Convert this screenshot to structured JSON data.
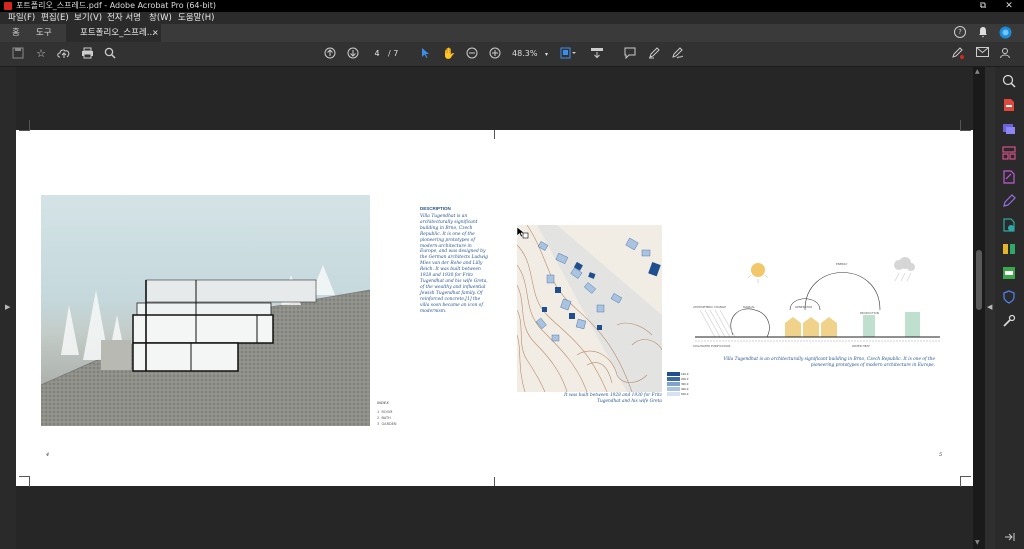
{
  "window": {
    "title": "포트폴리오_스프레드.pdf - Adobe Acrobat Pro (64-bit)",
    "controls": [
      "⧉",
      "✕"
    ]
  },
  "menu": [
    "파일(F)",
    "편집(E)",
    "보기(V)",
    "전자 서명",
    "창(W)",
    "도움말(H)"
  ],
  "tabs": {
    "home": "홈",
    "tools": "도구",
    "document": "포트폴리오_스프레...",
    "close": "×"
  },
  "toolbar": {
    "current_page": "4",
    "total_pages": "/ 7",
    "zoom": "48.3%",
    "zoom_caret": "▾"
  },
  "document": {
    "left_page_number": "4",
    "right_page_number": "5",
    "description_heading": "DESCRIPTION",
    "description_body": "Villa Tugendhat is an architecturally significant building in Brno, Czech Republic. It is one of the pioneering prototypes of modern architecture in Europe, and was designed by the German architects Ludwig Mies van der Rohe and Lilly Reich. It was built between 1928 and 1930 for Fritz Tugendhat and his wife Greta, of the wealthy and influential Jewish Tugendhat family. Of reinforced concrete,[1] the villa soon became an icon of modernism.",
    "legend_heading": "INDEX",
    "legend_items": [
      {
        "num": "1",
        "label": "ROOM"
      },
      {
        "num": "2",
        "label": "BATH"
      },
      {
        "num": "3",
        "label": "GARDEN"
      }
    ],
    "map_caption": "It was built between 1928 and 1930 for Fritz Tugendhat and his wife Greta",
    "map_legend": [
      "100.0",
      "200.0",
      "300.0",
      "400.0",
      "500.0"
    ],
    "diagram_caption": "Villa Tugendhat is an architecturally significant building in Brno, Czech Republic. It is one of the pioneering prototypes of modern architecture in Europe.",
    "diagram_labels": {
      "l1": "ATMOSPHERIC CHANGE",
      "l2": "MANUAL",
      "l3": "GENERATOR",
      "l4": "ENERGY",
      "l5": "PRODUCTION",
      "l6": "SOIL/WATER PURIFICATION",
      "l7": "WATER HEAT"
    }
  },
  "colors": {
    "accent_blue": "#1f4f8c",
    "acrobat_red": "#d7261e",
    "select_blue": "#3b8eea"
  }
}
